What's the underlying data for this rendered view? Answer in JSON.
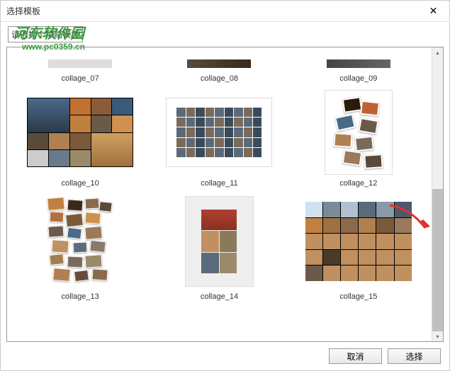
{
  "window": {
    "title": "选择模板"
  },
  "header": {
    "instruction_prefix": "请选择",
    "instruction_suffix": "个拼贴模板"
  },
  "watermark": {
    "brand": "河东软件园",
    "url": "www.pc0359.cn"
  },
  "templates": [
    {
      "label": "collage_07"
    },
    {
      "label": "collage_08"
    },
    {
      "label": "collage_09"
    },
    {
      "label": "collage_10"
    },
    {
      "label": "collage_11"
    },
    {
      "label": "collage_12"
    },
    {
      "label": "collage_13"
    },
    {
      "label": "collage_14"
    },
    {
      "label": "collage_15"
    }
  ],
  "buttons": {
    "cancel": "取消",
    "select": "选择"
  }
}
